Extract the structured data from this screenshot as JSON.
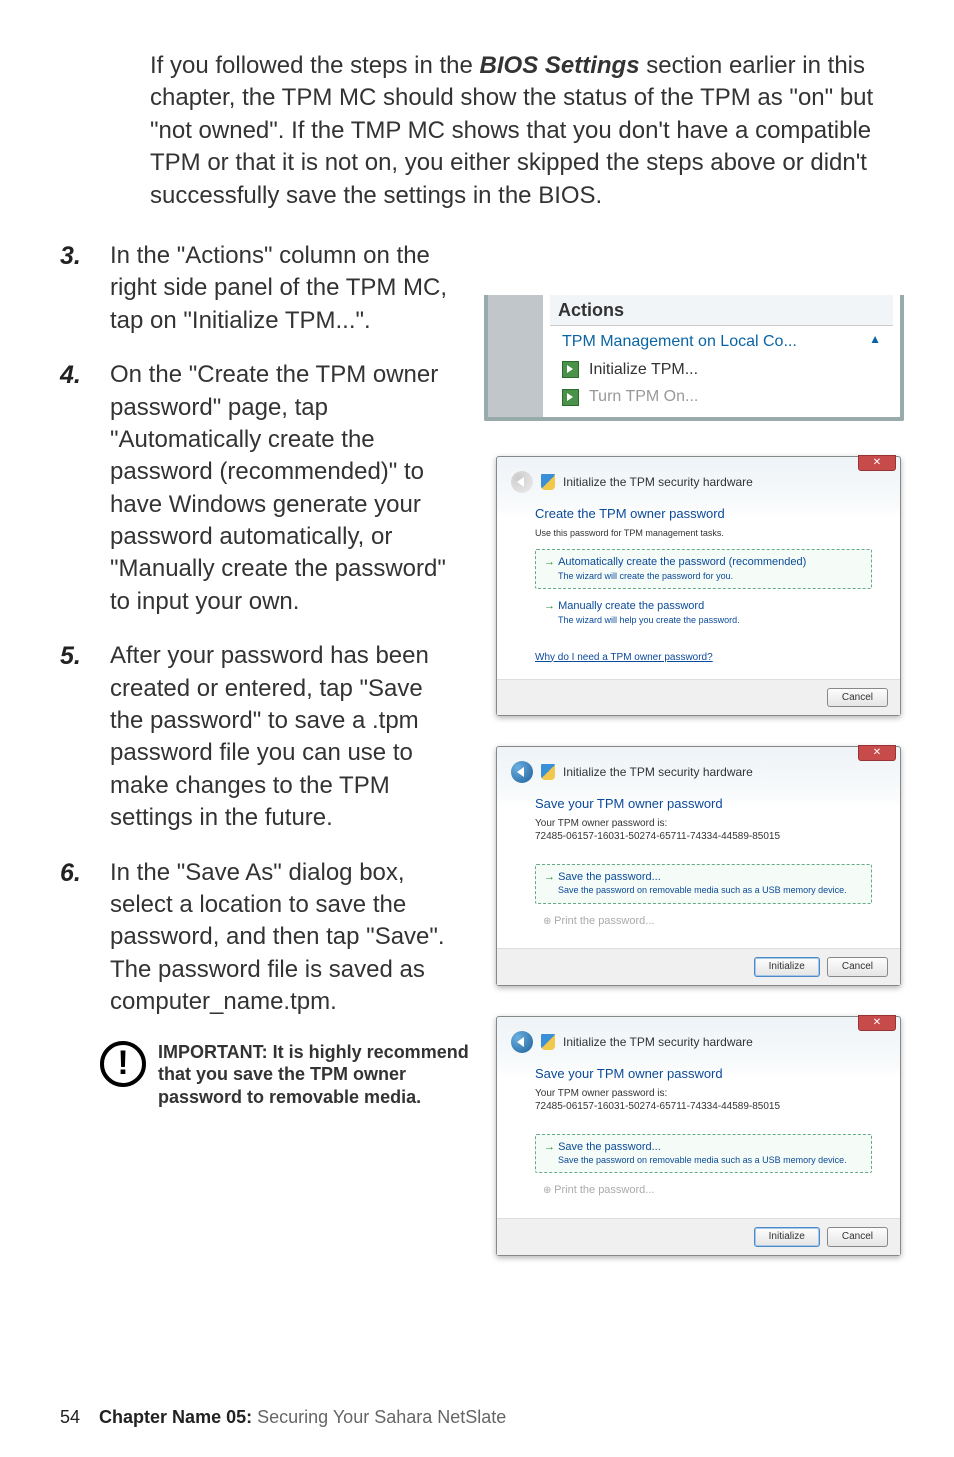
{
  "intro": "If you followed the steps in the BIOS Settings section earlier in this chapter, the TPM MC should show the status of the TPM as \"on\" but \"not owned\". If the TMP MC shows that you don't have a compatible TPM or that it is not on, you either skipped the steps above or didn't successfully save the settings in the BIOS.",
  "steps": {
    "s3": {
      "num": "3.",
      "text": "In the \"Actions\" column on the right side panel of the TPM MC, tap on \"Initialize TPM...\"."
    },
    "s4": {
      "num": "4.",
      "text": "On the \"Create the TPM owner password\" page, tap \"Automatically create the password (recommended)\" to have Windows generate your password automatically, or \"Manually create the password\" to input your own."
    },
    "s5": {
      "num": "5.",
      "text": "After your password has been created or entered, tap \"Save the password\" to save a .tpm password file you can use to make changes to the TPM settings in the future."
    },
    "s6": {
      "num": "6.",
      "text": "In the \"Save As\" dialog box, select a location to save the password, and then tap \"Save\". The password file is saved as computer_name.tpm."
    }
  },
  "important": "IMPORTANT: It is highly recommend that you save the TPM owner password to removable media.",
  "actions": {
    "title": "Actions",
    "group": "TPM Management on Local Co...",
    "init": "Initialize TPM...",
    "turn_on": "Turn TPM On..."
  },
  "dialog1": {
    "header": "Initialize the TPM security hardware",
    "title": "Create the TPM owner password",
    "sub": "Use this password for TPM management tasks.",
    "opt1_t": "Automatically create the password (recommended)",
    "opt1_d": "The wizard will create the password for you.",
    "opt2_t": "Manually create the password",
    "opt2_d": "The wizard will help you create the password.",
    "link": "Why do I need a TPM owner password?",
    "cancel": "Cancel"
  },
  "dialog2": {
    "header": "Initialize the TPM security hardware",
    "title": "Save your TPM owner password",
    "pw_label": "Your TPM owner password is:",
    "pw_value": "72485-06157-16031-50274-65711-74334-44589-85015",
    "save_t": "Save the password...",
    "save_d": "Save the password on removable media such as a USB memory device.",
    "print": "Print the password...",
    "initialize": "Initialize",
    "cancel": "Cancel"
  },
  "dialog3": {
    "header": "Initialize the TPM security hardware",
    "title": "Save your TPM owner password",
    "pw_label": "Your TPM owner password is:",
    "pw_value": "72485-06157-16031-50274-65711-74334-44589-85015",
    "save_t": "Save the password...",
    "save_d": "Save the password on removable media such as a USB memory device.",
    "print": "Print the password...",
    "initialize": "Initialize",
    "cancel": "Cancel"
  },
  "footer": {
    "page": "54",
    "chapter": "Chapter Name 05:",
    "rest": " Securing Your Sahara NetSlate"
  }
}
